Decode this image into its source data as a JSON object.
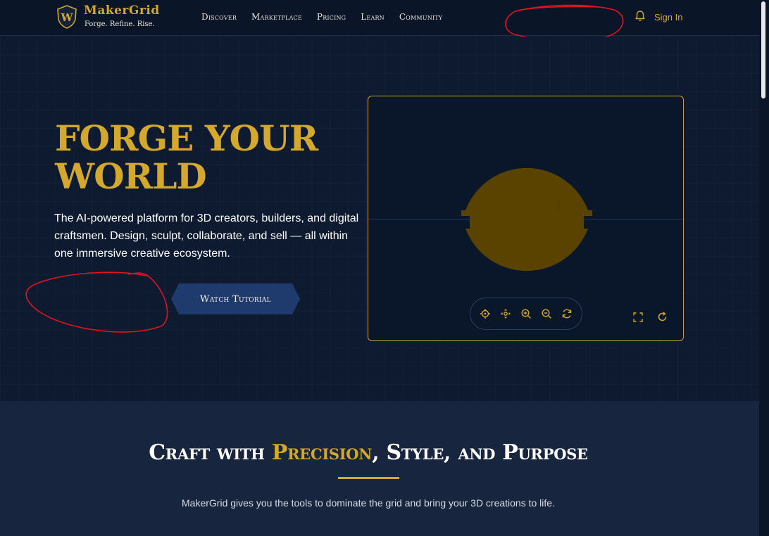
{
  "brand": {
    "name": "MakerGrid",
    "tagline": "Forge. Refine. Rise.",
    "badge_letter": "W"
  },
  "nav": {
    "items": [
      {
        "label": "Discover"
      },
      {
        "label": "Marketplace"
      },
      {
        "label": "Pricing"
      },
      {
        "label": "Learn"
      },
      {
        "label": "Community"
      }
    ]
  },
  "header": {
    "notification_icon": "bell-icon",
    "signin_label": "Sign In"
  },
  "hero": {
    "title": "FORGE YOUR WORLD",
    "description": "The AI-powered platform for 3D creators, builders, and digital craftsmen. Design, sculpt, collaborate, and sell — all within one immersive creative ecosystem.",
    "watch_button_label": "Watch Tutorial"
  },
  "viewer": {
    "toolbar_icons": [
      "target-icon",
      "move-icon",
      "zoom-in-icon",
      "zoom-out-icon",
      "reset-view-icon"
    ],
    "corner_icons": [
      "fullscreen-icon",
      "refresh-icon"
    ]
  },
  "section2": {
    "title_prefix": "Craft with ",
    "title_highlight": "Precision",
    "title_suffix": ", Style, and Purpose",
    "subtitle": "MakerGrid gives you the tools to dominate the grid and bring your 3D creations to life."
  },
  "colors": {
    "accent_gold": "#d4a82c",
    "background_navy": "#0d1a30",
    "button_blue": "#1f3b6e",
    "annotation_red": "#e0141e"
  }
}
